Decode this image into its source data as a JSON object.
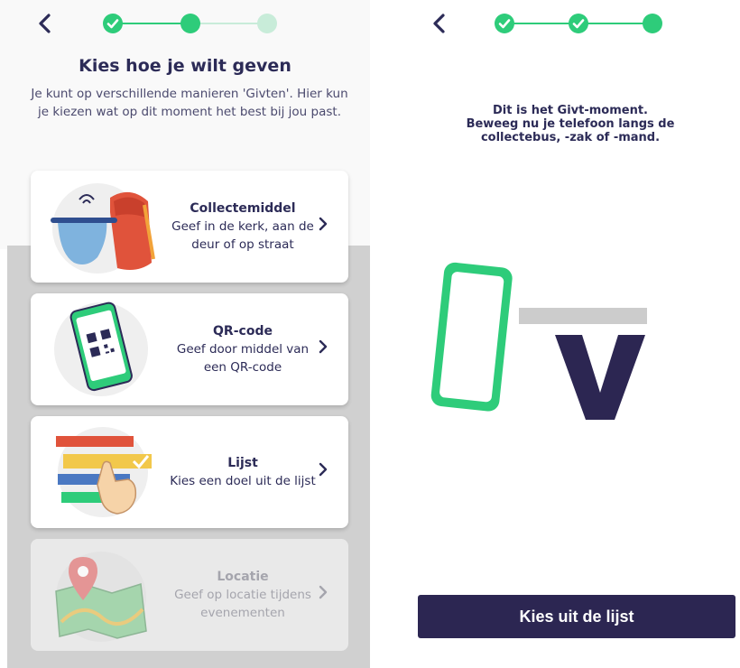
{
  "left_screen": {
    "back_icon": "chevron-left-icon",
    "progress": {
      "step_completed_icon": "check-icon",
      "current_step": 2,
      "total_steps": 3
    },
    "title": "Kies hoe je wilt geven",
    "intro": "Je kunt op verschillende manieren 'Givten'. Hier kun je kiezen wat op dit moment het best bij jou past.",
    "options": [
      {
        "title": "Collectemiddel",
        "description": "Geef in de kerk, aan de deur of op straat",
        "icon": "collection-bag-icon",
        "enabled": true
      },
      {
        "title": "QR-code",
        "description": "Geef door middel van een QR-code",
        "icon": "qr-code-phone-icon",
        "enabled": true
      },
      {
        "title": "Lijst",
        "description": "Kies een doel uit de lijst",
        "icon": "list-hand-icon",
        "enabled": true
      },
      {
        "title": "Locatie",
        "description": "Geef op locatie tijdens evenementen",
        "icon": "map-pin-icon",
        "enabled": false
      }
    ]
  },
  "right_screen": {
    "back_icon": "chevron-left-icon",
    "progress": {
      "step_completed_icon": "check-icon",
      "current_step": 3,
      "total_steps": 3
    },
    "message_lines": [
      "Dit is het Givt-moment.",
      "Beweeg nu je telefoon langs de",
      "collectebus, -zak of -mand."
    ],
    "illustration": "phone-and-givt-logo-icon",
    "cta_label": "Kies uit de lijst"
  },
  "colors": {
    "brand_green": "#2ecc7a",
    "light_green": "#c8ecd9",
    "dark_navy": "#2c2652",
    "text_navy": "#2c2b57",
    "disabled_text": "#a5a5ad"
  }
}
